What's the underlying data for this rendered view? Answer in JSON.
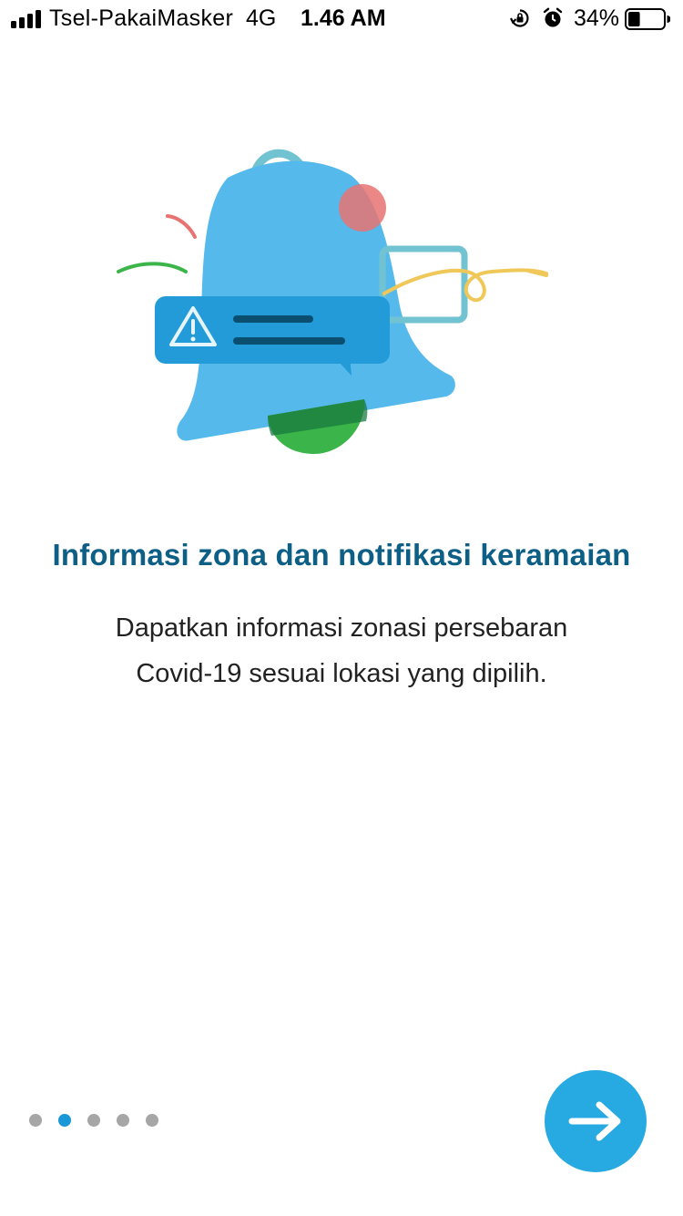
{
  "status_bar": {
    "carrier": "Tsel-PakaiMasker",
    "network": "4G",
    "time": "1.46 AM",
    "battery_percent": "34%",
    "battery_level": 0.34,
    "icons": [
      "signal-icon",
      "orientation-lock-icon",
      "alarm-icon",
      "battery-icon"
    ]
  },
  "onboarding": {
    "illustration": "bell-notification-illustration",
    "title": "Informasi zona dan notifikasi keramaian",
    "description_line1": "Dapatkan informasi zonasi persebaran",
    "description_line2": "Covid-19 sesuai lokasi yang dipilih."
  },
  "pager": {
    "total_pages": 5,
    "active_index": 1
  },
  "next_button": {
    "icon": "arrow-right-icon"
  },
  "colors": {
    "title": "#0d5f86",
    "accent": "#27a9e1",
    "dot_active": "#1a97d6",
    "dot_inactive": "#a6a6a6"
  }
}
